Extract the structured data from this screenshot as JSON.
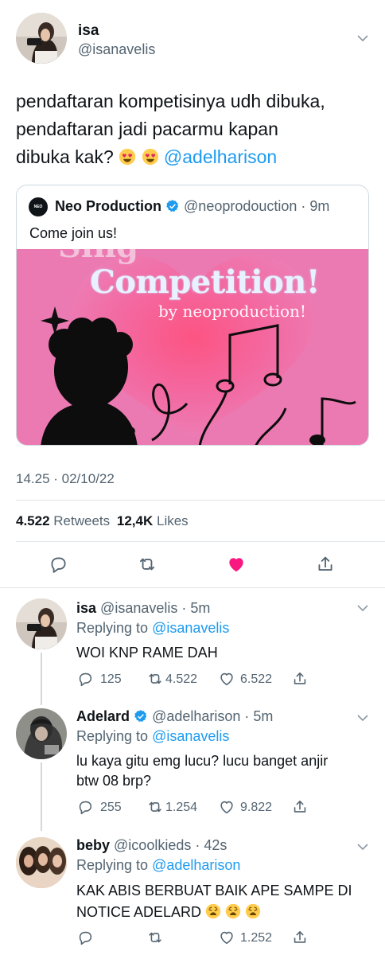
{
  "main_tweet": {
    "display_name": "isa",
    "handle": "@isanavelis",
    "text_line1": "pendaftaran kompetisinya udh dibuka,",
    "text_line2": "pendaftaran jadi pacarmu kapan",
    "text_line3_prefix": "dibuka kak?",
    "mention": "@adelharison",
    "timestamp": "14.25 · 02/10/22",
    "retweets_count": "4.522",
    "retweets_label": "Retweets",
    "likes_count": "12,4K",
    "likes_label": "Likes"
  },
  "quoted_tweet": {
    "display_name": "Neo Production",
    "handle": "@neoprodouction",
    "time": "· 9m",
    "text": "Come join us!",
    "logo_text": "NEO PROD",
    "image_title": "Competition!",
    "image_subtitle": "by neoproduction!"
  },
  "replies": [
    {
      "display_name": "isa",
      "handle": "@isanavelis",
      "time": "· 5m",
      "replying_prefix": "Replying to",
      "replying_to": "@isanavelis",
      "text_line1": "WOI KNP RAME DAH",
      "text_line2": "",
      "replies": "125",
      "retweets": "4.522",
      "likes": "6.522"
    },
    {
      "display_name": "Adelard",
      "handle": "@adelharison",
      "time": "· 5m",
      "replying_prefix": "Replying to",
      "replying_to": "@isanavelis",
      "text_line1": "lu kaya gitu emg lucu? lucu banget anjir",
      "text_line2": "btw 08 brp?",
      "replies": "255",
      "retweets": "1.254",
      "likes": "9.822"
    },
    {
      "display_name": "beby",
      "handle": "@icoolkieds",
      "time": "· 42s",
      "replying_prefix": "Replying to",
      "replying_to": "@adelharison",
      "text_line1": "KAK ABIS BERBUAT BAIK APE SAMPE DI",
      "text_line2": "NOTICE ADELARD",
      "replies": "",
      "retweets": "",
      "likes": "1.252"
    }
  ],
  "colors": {
    "accent": "#1d9bf0",
    "like_red": "#f91880",
    "text_secondary": "#536471",
    "pink_bg": "#f07ab0"
  },
  "icons": [
    "chevron-down-icon",
    "verified-badge-icon",
    "reply-icon",
    "retweet-icon",
    "heart-icon",
    "share-icon",
    "smiling-face-heart-eyes-emoji",
    "weary-face-emoji"
  ]
}
